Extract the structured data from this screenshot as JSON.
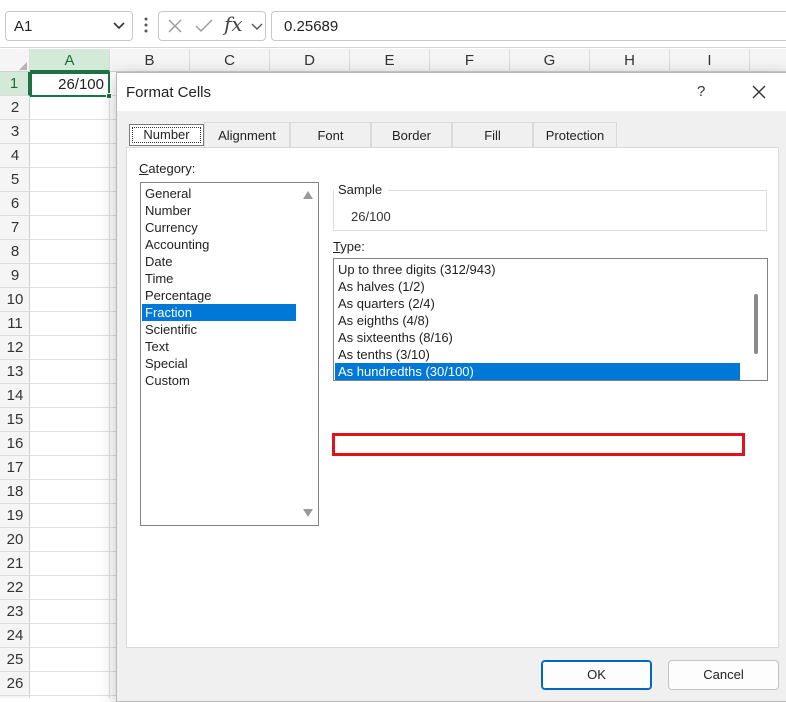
{
  "formula_bar": {
    "name_box": "A1",
    "fx": "fx",
    "formula_value": "0.25689"
  },
  "columns": [
    "A",
    "B",
    "C",
    "D",
    "E",
    "F",
    "G",
    "H",
    "I"
  ],
  "rows": [
    "1",
    "2",
    "3",
    "4",
    "5",
    "6",
    "7",
    "8",
    "9",
    "10",
    "11",
    "12",
    "13",
    "14",
    "15",
    "16",
    "17",
    "18",
    "19",
    "20",
    "21",
    "22",
    "23",
    "24",
    "25",
    "26"
  ],
  "cells": {
    "A1": "26/100"
  },
  "dialog": {
    "title": "Format Cells",
    "help": "?",
    "tabs": [
      "Number",
      "Alignment",
      "Font",
      "Border",
      "Fill",
      "Protection"
    ],
    "active_tab": "Number",
    "category_label_u": "C",
    "category_label_rest": "ategory:",
    "categories": [
      "General",
      "Number",
      "Currency",
      "Accounting",
      "Date",
      "Time",
      "Percentage",
      "Fraction",
      "Scientific",
      "Text",
      "Special",
      "Custom"
    ],
    "selected_category": "Fraction",
    "sample_label": "Sample",
    "sample_value": "26/100",
    "type_label_u": "T",
    "type_label_rest": "ype:",
    "types": [
      "Up to three digits (312/943)",
      "As halves (1/2)",
      "As quarters (2/4)",
      "As eighths (4/8)",
      "As sixteenths (8/16)",
      "As tenths (3/10)",
      "As hundredths (30/100)"
    ],
    "selected_type": "As hundredths (30/100)",
    "ok_label": "OK",
    "cancel_label": "Cancel"
  },
  "colors": {
    "accent_green": "#1e7145",
    "selection_blue": "#0078d7",
    "highlight_red": "#e3111c"
  }
}
